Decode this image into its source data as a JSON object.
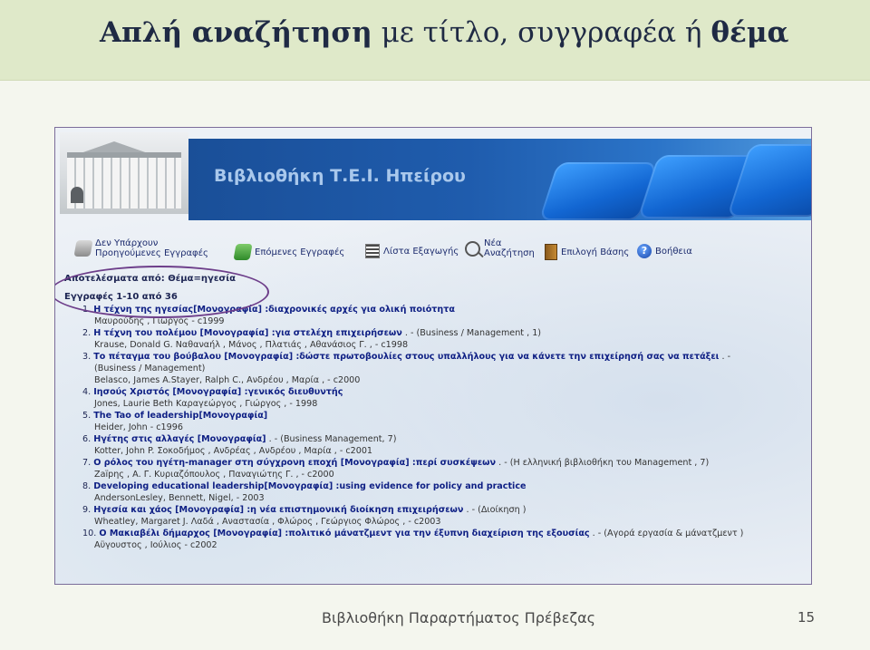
{
  "slide": {
    "title_bold_1": "Απλή αναζήτηση",
    "title_normal": " με τίτλο, συγγραφέα ή ",
    "title_bold_2": "θέμα",
    "footer": "Βιβλιοθήκη Παραρτήματος Πρέβεζας",
    "page_number": "15"
  },
  "banner": {
    "title": "Βιβλιοθήκη Τ.Ε.Ι. Ηπείρου"
  },
  "toolbar": {
    "prev_line1": "Δεν Υπάρχουν",
    "prev_line2": "Προηγούμενες Εγγραφές",
    "next": "Επόμενες Εγγραφές",
    "export": "Λίστα Εξαγωγής",
    "new_line1": "Νέα",
    "new_line2": "Αναζήτηση",
    "db": "Επιλογή Βάσης",
    "help": "Βοήθεια"
  },
  "results": {
    "header": "Αποτελέσματα από: Θέμα=ηγεσία",
    "count": "Εγγραφές 1-10 από 36",
    "items": [
      {
        "num": "1.",
        "title": "Η τέχνη της ηγεσίας[Μονογραφία] :διαχρονικές αρχές για ολική ποιότητα",
        "meta": "",
        "cont": "",
        "author": "Μαυρούδης , Γιώργος - c1999"
      },
      {
        "num": "2.",
        "title": "Η τέχνη του πολέμου [Μονογραφία] :για στελέχη επιχειρήσεων",
        "meta": ". - (Business / Management , 1)",
        "cont": "",
        "author": "Krause, Donald G. Ναθαναήλ , Μάνος , Πλατιάς , Αθανάσιος Γ. , - c1998"
      },
      {
        "num": "3.",
        "title": "Το πέταγμα του βούβαλου [Μονογραφία] :δώστε πρωτοβουλίες στους υπαλλήλους για να κάνετε την επιχείρησή σας να πετάξει",
        "meta": ". -",
        "cont": "(Business / Management)",
        "author": "Belasco, James A.Stayer, Ralph C., Ανδρέου , Μαρία , - c2000"
      },
      {
        "num": "4.",
        "title": "Ιησούς Χριστός [Μονογραφία] :γενικός διευθυντής",
        "meta": "",
        "cont": "",
        "author": "Jones, Laurie Beth Καραγεώργος , Γιώργος , - 1998"
      },
      {
        "num": "5.",
        "title": "The Tao of leadership[Μονογραφία]",
        "meta": "",
        "cont": "",
        "author": "Heider, John - c1996"
      },
      {
        "num": "6.",
        "title": "Ηγέτης στις αλλαγές [Μονογραφία]",
        "meta": ". - (Business Management, 7)",
        "cont": "",
        "author": "Kotter, John P. Σοκοδήμος , Ανδρέας , Ανδρέου , Μαρία , - c2001"
      },
      {
        "num": "7.",
        "title": "Ο ρόλος του ηγέτη-manager στη σύγχρονη εποχή [Μονογραφία] :περί συσκέψεων",
        "meta": ". - (Η ελληνική βιβλιοθήκη του Management , 7)",
        "cont": "",
        "author": "Zaïpης , Α. Γ. Κυριαζόπουλος , Παναγιώτης Γ. , - c2000"
      },
      {
        "num": "8.",
        "title": "Developing educational leadership[Μονογραφία] :using evidence for policy and practice",
        "meta": "",
        "cont": "",
        "author": "AndersonLesley, Bennett, Nigel, - 2003"
      },
      {
        "num": "9.",
        "title": "Ηγεσία και χάος [Μονογραφία] :η νέα επιστημονική διοίκηση επιχειρήσεων",
        "meta": ". - (Διοίκηση )",
        "cont": "",
        "author": "Wheatley, Margaret J. Λαδά , Αναστασία , Φλώρος , Γεώργιος Φλώρος , - c2003"
      },
      {
        "num": "10.",
        "title": "Ο Μακιαβέλι δήμαρχος [Μονογραφία] :πολιτικό μάνατζμεντ για την έξυπνη διαχείριση της εξουσίας",
        "meta": ". - (Αγορά εργασία & μάνατζμεντ )",
        "cont": "",
        "author": "Αϋγουστος , Ιούλιος - c2002"
      }
    ]
  }
}
